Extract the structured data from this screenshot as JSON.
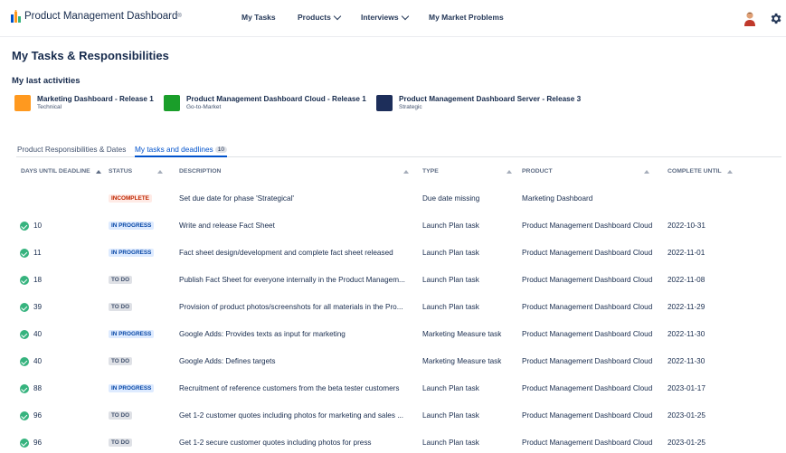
{
  "header": {
    "brand": "Product Management Dashboard",
    "brand_mark": "®",
    "nav": [
      {
        "label": "My Tasks",
        "dropdown": false
      },
      {
        "label": "Products",
        "dropdown": true
      },
      {
        "label": "Interviews",
        "dropdown": true
      },
      {
        "label": "My Market Problems",
        "dropdown": false
      }
    ],
    "icons": [
      "user-avatar",
      "gear-icon"
    ]
  },
  "page_title": "My Tasks & Responsibilities",
  "last_activities": {
    "title": "My last activities",
    "items": [
      {
        "name": "Marketing Dashboard - Release 1",
        "category": "Technical",
        "color": "#ff991f"
      },
      {
        "name": "Product Management Dashboard Cloud - Release 1",
        "category": "Go-to-Market",
        "color": "#1a9e2a"
      },
      {
        "name": "Product Management Dashboard Server - Release 3",
        "category": "Strategic",
        "color": "#1d2e5a"
      }
    ]
  },
  "tabs": [
    {
      "label": "Product Responsibilities & Dates",
      "active": false
    },
    {
      "label": "My tasks and deadlines",
      "count": "10",
      "active": true
    }
  ],
  "table": {
    "columns": [
      "DAYS UNTIL DEADLINE",
      "STATUS",
      "DESCRIPTION",
      "TYPE",
      "PRODUCT",
      "COMPLETE UNTIL"
    ],
    "rows": [
      {
        "days": "",
        "status": "INCOMPLETE",
        "description": "Set due date for phase 'Strategical'",
        "type": "Due date missing",
        "product": "Marketing Dashboard",
        "complete_until": ""
      },
      {
        "days": "10",
        "status": "IN PROGRESS",
        "description": "Write and release Fact Sheet",
        "type": "Launch Plan task",
        "product": "Product Management Dashboard Cloud",
        "complete_until": "2022-10-31"
      },
      {
        "days": "11",
        "status": "IN PROGRESS",
        "description": "Fact sheet design/development and complete fact sheet released",
        "type": "Launch Plan task",
        "product": "Product Management Dashboard Cloud",
        "complete_until": "2022-11-01"
      },
      {
        "days": "18",
        "status": "TO DO",
        "description": "Publish Fact Sheet for everyone internally in the Product Managem...",
        "type": "Launch Plan task",
        "product": "Product Management Dashboard Cloud",
        "complete_until": "2022-11-08"
      },
      {
        "days": "39",
        "status": "TO DO",
        "description": "Provision of product photos/screenshots for all materials in the Pro...",
        "type": "Launch Plan task",
        "product": "Product Management Dashboard Cloud",
        "complete_until": "2022-11-29"
      },
      {
        "days": "40",
        "status": "IN PROGRESS",
        "description": "Google Adds: Provides texts as input for marketing",
        "type": "Marketing Measure task",
        "product": "Product Management Dashboard Cloud",
        "complete_until": "2022-11-30"
      },
      {
        "days": "40",
        "status": "TO DO",
        "description": "Google Adds: Defines targets",
        "type": "Marketing Measure task",
        "product": "Product Management Dashboard Cloud",
        "complete_until": "2022-11-30"
      },
      {
        "days": "88",
        "status": "IN PROGRESS",
        "description": "Recruitment of reference customers from the beta tester customers",
        "type": "Launch Plan task",
        "product": "Product Management Dashboard Cloud",
        "complete_until": "2023-01-17"
      },
      {
        "days": "96",
        "status": "TO DO",
        "description": "Get 1-2 customer quotes including photos for marketing and sales ...",
        "type": "Launch Plan task",
        "product": "Product Management Dashboard Cloud",
        "complete_until": "2023-01-25"
      },
      {
        "days": "96",
        "status": "TO DO",
        "description": "Get 1-2 secure customer quotes including photos for press",
        "type": "Launch Plan task",
        "product": "Product Management Dashboard Cloud",
        "complete_until": "2023-01-25"
      }
    ]
  },
  "status_colors": {
    "INCOMPLETE": "#bf2600",
    "IN PROGRESS": "#0747a6",
    "TO DO": "#42526e"
  }
}
